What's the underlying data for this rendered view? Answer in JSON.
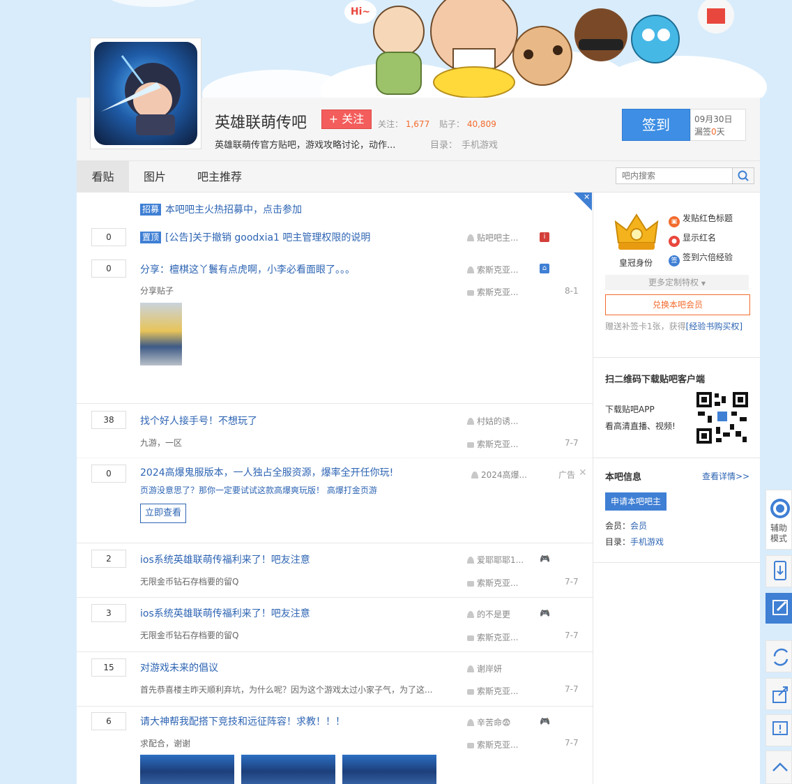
{
  "forum": {
    "name": "英雄联萌传吧",
    "follow_label": "+ 关注",
    "follow_count_label": "关注：",
    "follow_count": "1,677",
    "post_count_label": "贴子：",
    "post_count": "40,809",
    "slogan": "英雄联萌传官方贴吧，游戏攻略讨论，动作...",
    "catalog_label": "目录：",
    "catalog": "手机游戏"
  },
  "sign": {
    "label": "签到",
    "date": "09月30日",
    "missed_prefix": "漏签",
    "missed_count": "0",
    "missed_suffix": "天"
  },
  "banner": {
    "bubble": "Hi~"
  },
  "nav": {
    "tabs": [
      "看贴",
      "图片",
      "吧主推荐"
    ],
    "search_placeholder": "吧内搜索"
  },
  "threads": {
    "recruit": {
      "tag": "招募",
      "title": "本吧吧主火热招募中，点击参加"
    },
    "items": [
      {
        "replies": "0",
        "tag": "置顶",
        "title": "[公告]关于撤销 goodxia1 吧主管理权限的说明",
        "author": "贴吧吧主...",
        "abstract": "",
        "last": "",
        "time": ""
      },
      {
        "replies": "0",
        "title": "分享：檀棋这丫鬟有点虎啊，小李必看面眼了。。。",
        "author": "索斯克亚...",
        "abstract": "分享贴子",
        "last": "索斯克亚...",
        "time": "8-1"
      },
      {
        "replies": "38",
        "title": "找个好人接手号！不想玩了",
        "author": "村姑的诱...",
        "abstract": "九游，一区",
        "last": "索斯克亚...",
        "time": "7-7"
      },
      {
        "replies": "0",
        "title": "2024高爆鬼服版本，一人独占全服资源，爆率全开任你玩!",
        "author": "2024高爆...",
        "abstract": "页游没意思了？那你一定要试试这款高爆爽玩版！ 高爆打金页游",
        "ad_label": "广告",
        "ad_button": "立即查看"
      },
      {
        "replies": "2",
        "title": "ios系统英雄联萌传福利来了！吧友注意",
        "author": "爱耶耶耶1...",
        "abstract": "无限金币钻石存档要的留Q",
        "last": "索斯克亚...",
        "time": "7-7"
      },
      {
        "replies": "3",
        "title": "ios系统英雄联萌传福利来了！吧友注意",
        "author": "的不是更",
        "abstract": "无限金币钻石存档要的留Q",
        "last": "索斯克亚...",
        "time": "7-7"
      },
      {
        "replies": "15",
        "title": "对游戏未来的倡议",
        "author": "谢岸妍",
        "abstract": "首先恭喜楼主昨天顺利弃坑，为什么呢？因为这个游戏太过小家子气，为了这...",
        "last": "索斯克亚...",
        "time": "7-7"
      },
      {
        "replies": "6",
        "title": "请大神帮我配搭下竞技和远征阵容！求教！！！",
        "author": "辛苦命😨",
        "abstract": "求配合，谢谢",
        "last": "索斯克亚...",
        "time": "7-7"
      }
    ]
  },
  "aside": {
    "crown_label": "皇冠身份",
    "perks": [
      "发贴红色标题",
      "显示红名",
      "签到六倍经验"
    ],
    "perk_icon_sign": "签",
    "more_perks": "更多定制特权",
    "vip_button": "兑换本吧会员",
    "vip_tip_prefix": "赠送补签卡1张，获得",
    "vip_tip_link": "[经验书购买权]",
    "app_title": "扫二维码下载贴吧客户端",
    "app_line1": "下载贴吧APP",
    "app_line2": "看高清直播、视频!",
    "info_title": "本吧信息",
    "info_more": "查看详情>>",
    "apply_button": "申请本吧吧主",
    "member_label": "会员：",
    "member_value": "会员",
    "catalog_label": "目录：",
    "catalog_value": "手机游戏"
  },
  "sidebar": {
    "assist_line1": "辅助",
    "assist_line2": "模式"
  },
  "colors": {
    "brand_blue": "#3f7fd4",
    "accent_red": "#f35d5b",
    "accent_orange": "#f26b2d",
    "banner_sky": "#d9ecfb"
  }
}
